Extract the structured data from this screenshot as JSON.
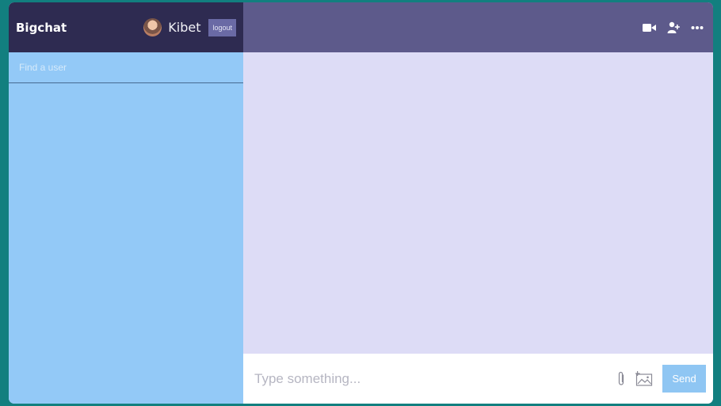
{
  "sidebar": {
    "brand": "Bigchat",
    "user": {
      "name": "Kibet"
    },
    "logout_label": "logout",
    "search": {
      "placeholder": "Find a user"
    }
  },
  "chat": {
    "header_icons": [
      "video-camera-icon",
      "add-user-icon",
      "more-options-icon"
    ],
    "input": {
      "placeholder": "Type something..."
    },
    "send_label": "Send",
    "tool_icons": [
      "attachment-icon",
      "add-image-icon"
    ]
  },
  "colors": {
    "sidebar_bg": "#93c9f7",
    "navbar_bg": "#2e2b51",
    "chat_header_bg": "#5d5a8b",
    "messages_bg": "#dddcf6",
    "send_button_bg": "#8fc6f3"
  }
}
